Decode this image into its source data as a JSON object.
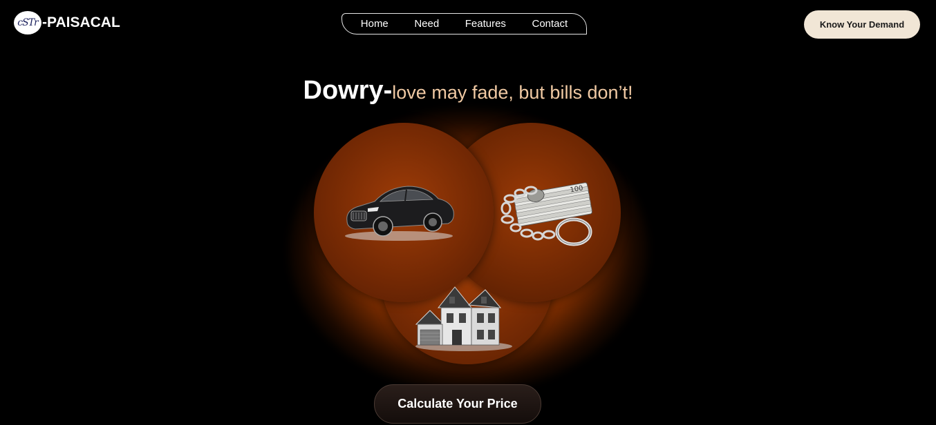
{
  "header": {
    "logo_badge": "cSTr",
    "logo_text": "-PAISACAL",
    "nav": [
      {
        "label": "Home"
      },
      {
        "label": "Need"
      },
      {
        "label": "Features"
      },
      {
        "label": "Contact"
      }
    ],
    "demand_button": "Know Your Demand"
  },
  "hero": {
    "headline_main": "Dowry-",
    "headline_tag": "love may fade, but bills don’t!",
    "items": [
      {
        "icon": "car-icon"
      },
      {
        "icon": "money-stack-icon"
      },
      {
        "icon": "house-icon"
      }
    ]
  },
  "cta": {
    "label": "Calculate Your Price"
  },
  "colors": {
    "background": "#000000",
    "accent_orange": "#e0620e",
    "tagline": "#f0c9a3",
    "demand_button_bg": "#f1e6d6"
  }
}
